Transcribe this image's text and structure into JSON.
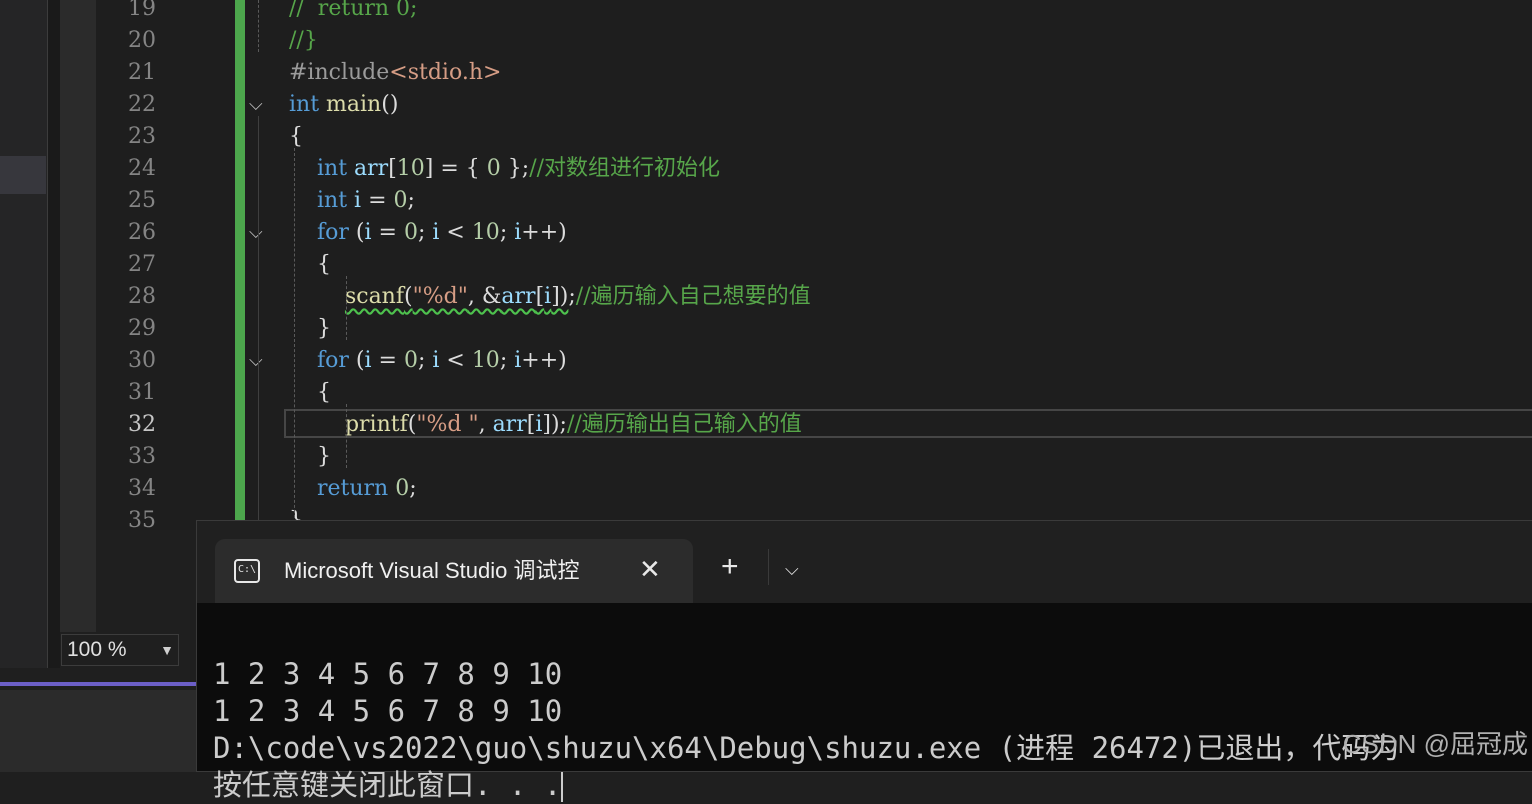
{
  "editor": {
    "line_numbers": [
      "19",
      "20",
      "21",
      "22",
      "23",
      "24",
      "25",
      "26",
      "27",
      "28",
      "29",
      "30",
      "31",
      "32",
      "33",
      "34",
      "35"
    ],
    "current_line": "32",
    "lines": [
      [
        {
          "t": "//  return 0;",
          "c": "cm"
        }
      ],
      [
        {
          "t": "//}",
          "c": "cm"
        }
      ],
      [
        {
          "t": "#include",
          "c": "pp"
        },
        {
          "t": "<stdio.h>",
          "c": "inc"
        }
      ],
      [
        {
          "t": "int",
          "c": "kw"
        },
        {
          "t": " "
        },
        {
          "t": "main",
          "c": "fn"
        },
        {
          "t": "()"
        }
      ],
      [
        {
          "t": "{"
        }
      ],
      [
        {
          "t": "    "
        },
        {
          "t": "int",
          "c": "kw"
        },
        {
          "t": " "
        },
        {
          "t": "arr",
          "c": "var"
        },
        {
          "t": "["
        },
        {
          "t": "10",
          "c": "num"
        },
        {
          "t": "] = { "
        },
        {
          "t": "0",
          "c": "num"
        },
        {
          "t": " };"
        },
        {
          "t": "//对数组进行初始化",
          "c": "cm"
        }
      ],
      [
        {
          "t": "    "
        },
        {
          "t": "int",
          "c": "kw"
        },
        {
          "t": " "
        },
        {
          "t": "i",
          "c": "var"
        },
        {
          "t": " = "
        },
        {
          "t": "0",
          "c": "num"
        },
        {
          "t": ";"
        }
      ],
      [
        {
          "t": "    "
        },
        {
          "t": "for",
          "c": "kw"
        },
        {
          "t": " ("
        },
        {
          "t": "i",
          "c": "var"
        },
        {
          "t": " = "
        },
        {
          "t": "0",
          "c": "num"
        },
        {
          "t": "; "
        },
        {
          "t": "i",
          "c": "var"
        },
        {
          "t": " < "
        },
        {
          "t": "10",
          "c": "num"
        },
        {
          "t": "; "
        },
        {
          "t": "i",
          "c": "var"
        },
        {
          "t": "++)"
        }
      ],
      [
        {
          "t": "    {"
        }
      ],
      [
        {
          "t": "        "
        },
        {
          "t": "scanf",
          "c": "fn squig"
        },
        {
          "t": "(",
          "c": "squig"
        },
        {
          "t": "\"%d\"",
          "c": "str squig"
        },
        {
          "t": ", &",
          "c": "squig"
        },
        {
          "t": "arr",
          "c": "var squig"
        },
        {
          "t": "[",
          "c": "squig"
        },
        {
          "t": "i",
          "c": "var squig"
        },
        {
          "t": "])",
          "c": "squig"
        },
        {
          "t": ";"
        },
        {
          "t": "//遍历输入自己想要的值",
          "c": "cm"
        }
      ],
      [
        {
          "t": "    }"
        }
      ],
      [
        {
          "t": "    "
        },
        {
          "t": "for",
          "c": "kw"
        },
        {
          "t": " ("
        },
        {
          "t": "i",
          "c": "var"
        },
        {
          "t": " = "
        },
        {
          "t": "0",
          "c": "num"
        },
        {
          "t": "; "
        },
        {
          "t": "i",
          "c": "var"
        },
        {
          "t": " < "
        },
        {
          "t": "10",
          "c": "num"
        },
        {
          "t": "; "
        },
        {
          "t": "i",
          "c": "var"
        },
        {
          "t": "++)"
        }
      ],
      [
        {
          "t": "    {"
        }
      ],
      [
        {
          "t": "        "
        },
        {
          "t": "printf",
          "c": "fn"
        },
        {
          "t": "("
        },
        {
          "t": "\"%d \"",
          "c": "str"
        },
        {
          "t": ", "
        },
        {
          "t": "arr",
          "c": "var"
        },
        {
          "t": "["
        },
        {
          "t": "i",
          "c": "var"
        },
        {
          "t": "]);"
        },
        {
          "t": "//遍历输出自己输入的值",
          "c": "cm"
        }
      ],
      [
        {
          "t": "    }"
        }
      ],
      [
        {
          "t": "    "
        },
        {
          "t": "return",
          "c": "kw"
        },
        {
          "t": " "
        },
        {
          "t": "0",
          "c": "num"
        },
        {
          "t": ";"
        }
      ],
      [
        {
          "t": "}"
        }
      ]
    ],
    "zoom": "100 %"
  },
  "terminal": {
    "tab_title": "Microsoft Visual Studio 调试控",
    "icon_text": "C:\\",
    "output_lines": [
      "1 2 3 4 5 6 7 8 9 10",
      "1 2 3 4 5 6 7 8 9 10",
      "D:\\code\\vs2022\\guo\\shuzu\\x64\\Debug\\shuzu.exe (进程 26472)已退出，代码为",
      "按任意键关闭此窗口. . ."
    ]
  },
  "watermark": "CSDN @屈冠成"
}
